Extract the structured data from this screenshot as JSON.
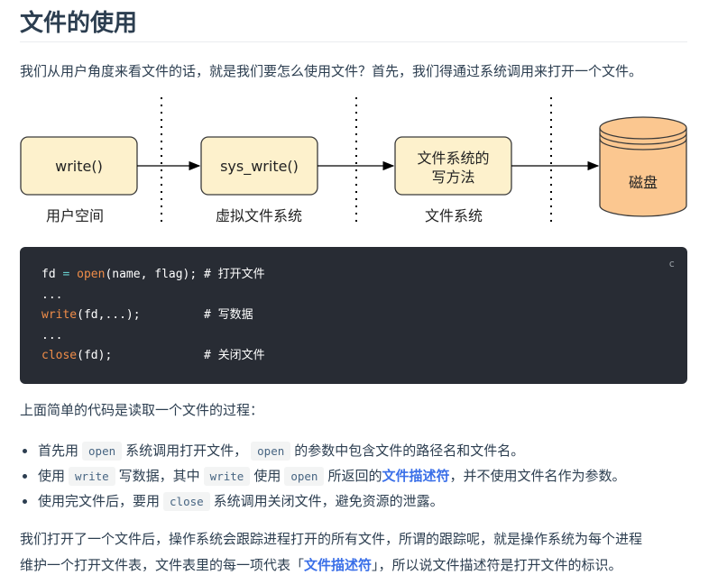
{
  "heading": "文件的使用",
  "intro": "我们从用户角度来看文件的话，就是我们要怎么使用文件？首先，我们得通过系统调用来打开一个文件。",
  "diagram": {
    "boxes": [
      "write()",
      "sys_write()",
      "文件系统的",
      "写方法",
      "磁盘"
    ],
    "layers": [
      "用户空间",
      "虚拟文件系统",
      "文件系统"
    ],
    "colors": {
      "box_fill": "#fdf1cc",
      "box_stroke": "#3a3a3a",
      "disk_fill": "#fbc790"
    }
  },
  "code": {
    "lang": "c",
    "lines": [
      {
        "parts": [
          {
            "t": "fd "
          },
          {
            "t": "=",
            "c": "op"
          },
          {
            "t": " "
          },
          {
            "t": "open",
            "c": "fn"
          },
          {
            "t": "(name, flag); # 打开文件"
          }
        ]
      },
      {
        "parts": [
          {
            "t": "..."
          }
        ]
      },
      {
        "parts": [
          {
            "t": "write",
            "c": "fn"
          },
          {
            "t": "(fd,...);         # 写数据"
          }
        ]
      },
      {
        "parts": [
          {
            "t": "..."
          }
        ]
      },
      {
        "parts": [
          {
            "t": "close",
            "c": "fn"
          },
          {
            "t": "(fd);             # 关闭文件"
          }
        ]
      }
    ]
  },
  "para2": "上面简单的代码是读取一个文件的过程：",
  "bullets": {
    "b1": {
      "t1": "首先用",
      "c1": "open",
      "t2": "系统调用打开文件，",
      "c2": "open",
      "t3": "的参数中包含文件的路径名和文件名。"
    },
    "b2": {
      "t1": "使用",
      "c1": "write",
      "t2": "写数据，其中",
      "c2": "write",
      "t3": "使用",
      "c3": "open",
      "t4": "所返回的",
      "link": "文件描述符",
      "t5": "，并不使用文件名作为参数。"
    },
    "b3": {
      "t1": "使用完文件后，要用",
      "c1": "close",
      "t2": "系统调用关闭文件，避免资源的泄露。"
    }
  },
  "para3": {
    "line1": "我们打开了一个文件后，操作系统会跟踪进程打开的所有文件，所谓的跟踪呢，就是操作系统为每个进程",
    "line2a": "维护一个打开文件表，文件表里的每一项代表「",
    "link": "文件描述符",
    "line2b": "」，所以说文件描述符是打开文件的标识。"
  }
}
